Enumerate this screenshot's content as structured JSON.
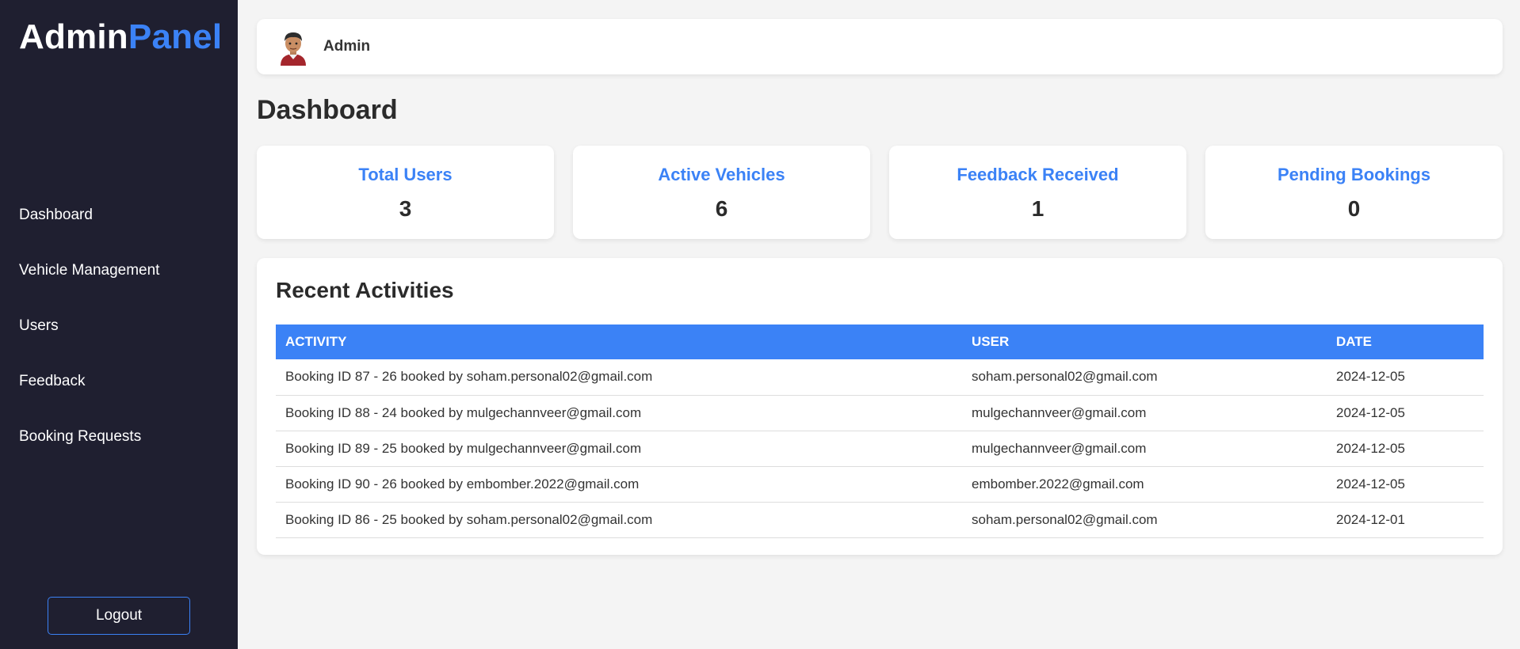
{
  "sidebar": {
    "logo_part1": "Admin",
    "logo_part2": "Panel",
    "items": [
      {
        "label": "Dashboard"
      },
      {
        "label": "Vehicle Management"
      },
      {
        "label": "Users"
      },
      {
        "label": "Feedback"
      },
      {
        "label": "Booking Requests"
      }
    ],
    "logout_label": "Logout"
  },
  "header": {
    "user_name": "Admin",
    "avatar_icon": "user-avatar-icon"
  },
  "main": {
    "title": "Dashboard",
    "stats": [
      {
        "label": "Total Users",
        "value": "3"
      },
      {
        "label": "Active Vehicles",
        "value": "6"
      },
      {
        "label": "Feedback Received",
        "value": "1"
      },
      {
        "label": "Pending Bookings",
        "value": "0"
      }
    ],
    "activities": {
      "title": "Recent Activities",
      "columns": [
        "ACTIVITY",
        "USER",
        "DATE"
      ],
      "rows": [
        {
          "activity": "Booking ID 87 - 26 booked by soham.personal02@gmail.com",
          "user": "soham.personal02@gmail.com",
          "date": "2024-12-05"
        },
        {
          "activity": "Booking ID 88 - 24 booked by mulgechannveer@gmail.com",
          "user": "mulgechannveer@gmail.com",
          "date": "2024-12-05"
        },
        {
          "activity": "Booking ID 89 - 25 booked by mulgechannveer@gmail.com",
          "user": "mulgechannveer@gmail.com",
          "date": "2024-12-05"
        },
        {
          "activity": "Booking ID 90 - 26 booked by embomber.2022@gmail.com",
          "user": "embomber.2022@gmail.com",
          "date": "2024-12-05"
        },
        {
          "activity": "Booking ID 86 - 25 booked by soham.personal02@gmail.com",
          "user": "soham.personal02@gmail.com",
          "date": "2024-12-01"
        }
      ]
    }
  },
  "colors": {
    "sidebar_bg": "#1f1f30",
    "accent": "#3b82f6",
    "page_bg": "#f4f4f4"
  }
}
